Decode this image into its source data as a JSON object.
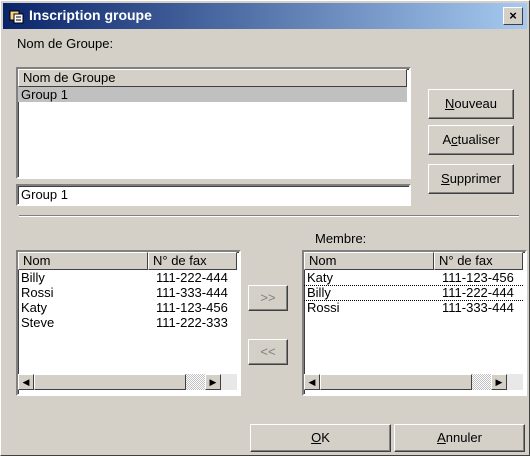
{
  "window": {
    "title": "Inscription groupe",
    "close_label": "×"
  },
  "group_section": {
    "label": "Nom de Groupe:",
    "list_header": "Nom de Groupe",
    "items": [
      "Group 1"
    ],
    "input_value": "Group 1"
  },
  "buttons": {
    "nouveau_pre": "",
    "nouveau_ul": "N",
    "nouveau_post": "ouveau",
    "actualiser_pre": "A",
    "actualiser_ul": "c",
    "actualiser_post": "tualiser",
    "supprimer_pre": "",
    "supprimer_ul": "S",
    "supprimer_post": "upprimer",
    "add": ">>",
    "remove": "<<",
    "ok_ul": "O",
    "ok_post": "K",
    "annuler_ul": "A",
    "annuler_post": "nnuler"
  },
  "contacts": {
    "headers": [
      "Nom",
      "N° de fax"
    ],
    "rows": [
      [
        "Billy",
        "111-222-444"
      ],
      [
        "Rossi",
        "111-333-444"
      ],
      [
        "Katy",
        "111-123-456"
      ],
      [
        "Steve",
        "111-222-333"
      ]
    ]
  },
  "members": {
    "label": "Membre:",
    "headers": [
      "Nom",
      "N° de fax"
    ],
    "rows": [
      [
        "Katy",
        "111-123-456"
      ],
      [
        "Billy",
        "111-222-444"
      ],
      [
        "Rossi",
        "111-333-444"
      ]
    ]
  }
}
